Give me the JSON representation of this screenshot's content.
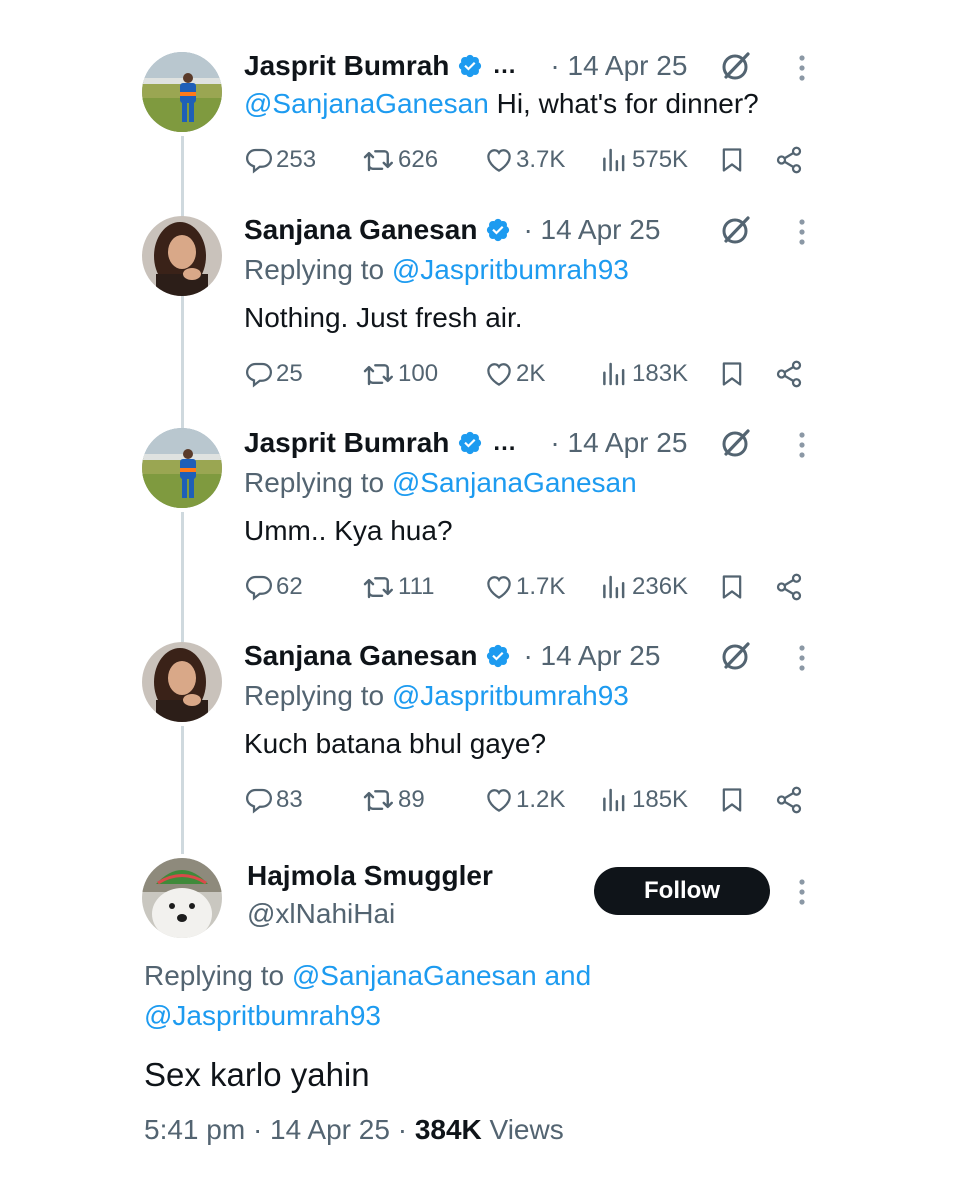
{
  "tweets": [
    {
      "name": "Jasprit Bumrah",
      "ellipsis": "...",
      "date": "· 14 Apr 25",
      "mention": "@SanjanaGanesan",
      "text": " Hi, what's for dinner?",
      "replies": "253",
      "retweets": "626",
      "likes": "3.7K",
      "views": "575K"
    },
    {
      "name": "Sanjana Ganesan",
      "date": "· 14 Apr 25",
      "replying_prefix": "Replying to ",
      "replying_handle": "@Jaspritbumrah93",
      "text": "Nothing. Just fresh air.",
      "replies": "25",
      "retweets": "100",
      "likes": "2K",
      "views": "183K"
    },
    {
      "name": "Jasprit Bumrah",
      "ellipsis": "...",
      "date": "· 14 Apr 25",
      "replying_prefix": "Replying to ",
      "replying_handle": "@SanjanaGanesan",
      "text": "Umm.. Kya hua?",
      "replies": "62",
      "retweets": "111",
      "likes": "1.7K",
      "views": "236K"
    },
    {
      "name": "Sanjana Ganesan",
      "date": "· 14 Apr 25",
      "replying_prefix": "Replying to ",
      "replying_handle": "@Jaspritbumrah93",
      "text": "Kuch batana bhul gaye?",
      "replies": "83",
      "retweets": "89",
      "likes": "1.2K",
      "views": "185K"
    }
  ],
  "main_tweet": {
    "name": "Hajmola Smuggler",
    "handle": "@xlNahiHai",
    "follow_label": "Follow",
    "replying_prefix": "Replying to ",
    "replying_handle_1": "@SanjanaGanesan",
    "replying_and": " and",
    "replying_handle_2": "@Jaspritbumrah93",
    "text": "Sex karlo yahin",
    "time": "5:41 pm · 14 Apr 25 · ",
    "views_count": "384K",
    "views_label": " Views"
  },
  "colors": {
    "link": "#1d9bf0",
    "muted": "#536471",
    "text": "#0f1419",
    "verified": "#1d9bf0",
    "thread_line": "#cfd9de"
  },
  "icons": [
    "verified-badge-icon",
    "grok-icon",
    "more-options-icon",
    "reply-icon",
    "retweet-icon",
    "like-icon",
    "views-icon",
    "bookmark-icon",
    "share-icon"
  ]
}
